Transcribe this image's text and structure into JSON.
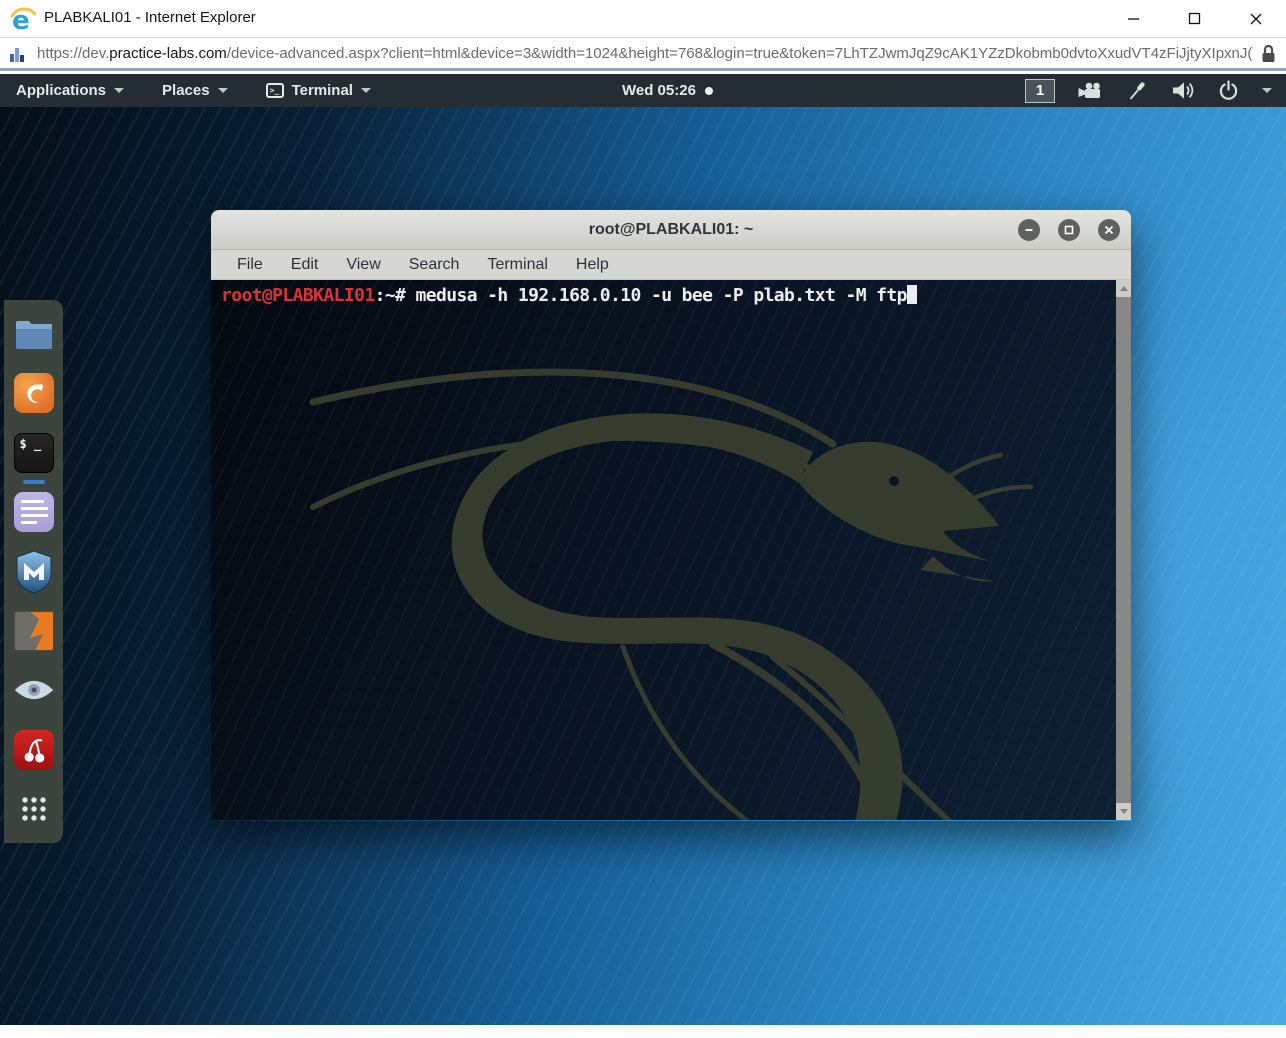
{
  "browser": {
    "window_title": "PLABKALI01 - Internet Explorer",
    "url_prefix": "https://dev.",
    "url_domain": "practice-labs.com",
    "url_rest": "/device-advanced.aspx?client=html&device=3&width=1024&height=768&login=true&token=7LhTZJwmJqZ9cAK1YZzDkobmb0dvtoXxudVT4zFiJjtyXIpxnJ(",
    "window_controls": [
      "minimize-icon",
      "maximize-icon",
      "close-icon"
    ]
  },
  "topbar": {
    "menu_applications": "Applications",
    "menu_places": "Places",
    "menu_terminal": "Terminal",
    "clock": "Wed 05:26",
    "workspace_number": "1",
    "right_icons": [
      "video-camera-icon",
      "screwdriver-icon",
      "volume-icon",
      "power-icon",
      "chevron-down-icon"
    ]
  },
  "dock": {
    "icons": [
      "file-manager-icon",
      "firefox-icon",
      "terminal-app-icon",
      "text-editor-icon",
      "metasploit-icon",
      "burpsuite-icon",
      "eye-icon",
      "cherrytree-icon",
      "app-grid-icon"
    ],
    "running_app": "terminal"
  },
  "terminal_window": {
    "title": "root@PLABKALI01: ~",
    "menu_items": [
      "File",
      "Edit",
      "View",
      "Search",
      "Terminal",
      "Help"
    ],
    "window_buttons": [
      "minimize-icon",
      "restore-icon",
      "close-icon"
    ],
    "prompt_user_host": "root@PLABKALI01",
    "prompt_suffix": ":~#",
    "command": " medusa -h 192.168.0.10 -u bee -P plab.txt -M ftp",
    "cursor_visible": true
  },
  "colors": {
    "prompt_red": "#d93434",
    "terminal_bg": "#0a1420",
    "wallpaper_blue": "#2c87c4",
    "dock_bg": "#3b453e",
    "term_titlebar": "#d9dad5",
    "gnome_bar": "#232d33"
  }
}
